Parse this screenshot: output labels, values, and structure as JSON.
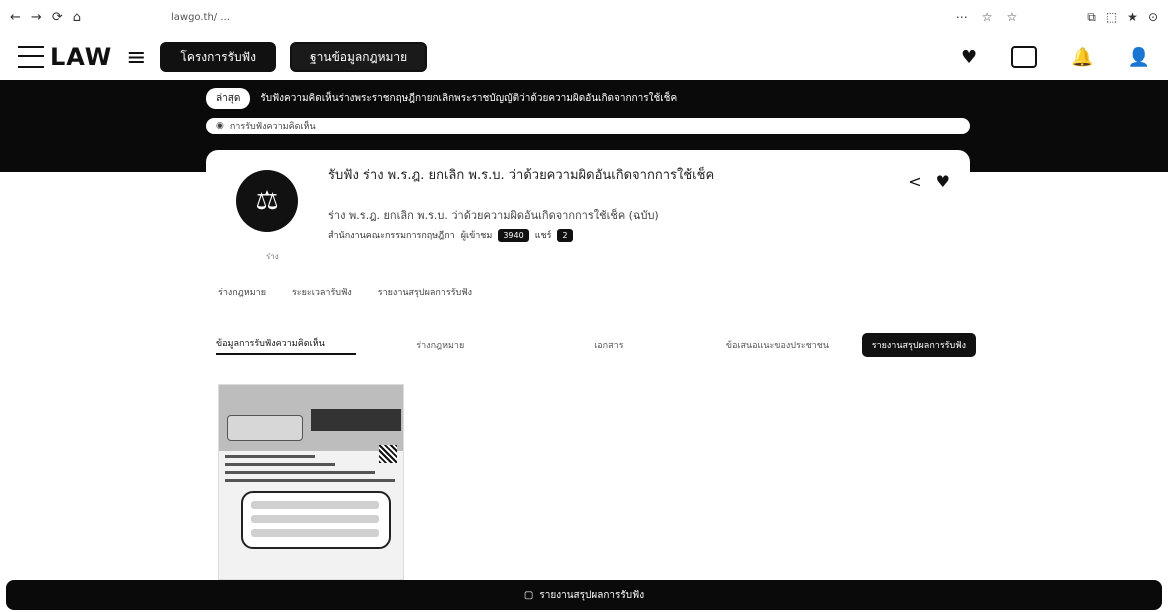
{
  "browser": {
    "nav_icons": [
      "←",
      "→",
      "⟳",
      "⌂"
    ],
    "url": "lawgo.th/ ... ",
    "right_icons": [
      "⋯",
      "☆",
      "☆"
    ],
    "right_icons2": [
      "⧉",
      "⬚",
      "★",
      "⊙"
    ]
  },
  "header": {
    "logo_text": "LAW",
    "menu_icon": "≡",
    "btn1": "โครงการรับฟัง",
    "btn2": "ฐานข้อมูลกฎหมาย",
    "icons": [
      "♥",
      "",
      "🔔",
      "👤"
    ]
  },
  "banner": {
    "pill": "ล่าสุด",
    "headline": "รับฟังความคิดเห็นร่างพระราชกฤษฎีกายกเลิกพระราชบัญญัติว่าด้วยความผิดอันเกิดจากการใช้เช็ค",
    "search_text": "การรับฟังความคิดเห็น"
  },
  "card": {
    "icon": "⚖",
    "small_text": "ร่าง",
    "title": "รับฟัง ร่าง พ.ร.ฎ. ยกเลิก พ.ร.บ. ว่าด้วยความผิดอันเกิดจากการใช้เช็ค",
    "desc": "ร่าง พ.ร.ฎ. ยกเลิก พ.ร.บ. ว่าด้วยความผิดอันเกิดจากการใช้เช็ค (ฉบับ)",
    "meta_agency": "สำนักงานคณะกรรมการกฤษฎีกา",
    "meta_views_label": "ผู้เข้าชม",
    "meta_views": "3940",
    "meta_share_label": "แชร์",
    "meta_shares": "2",
    "row2_link": "ร่างกฎหมาย",
    "row2_date": "ระยะเวลารับฟัง",
    "row2_report": "รายงานสรุปผลการรับฟัง",
    "share_icon": "<",
    "like_icon": "♥"
  },
  "tabs": [
    "ข้อมูลการรับฟังความคิดเห็น",
    "ร่างกฎหมาย",
    "เอกสาร",
    "ข้อเสนอแนะของประชาชน"
  ],
  "tab_button": "รายงานสรุปผลการรับฟัง",
  "bottom_bar": "รายงานสรุปผลการรับฟัง"
}
